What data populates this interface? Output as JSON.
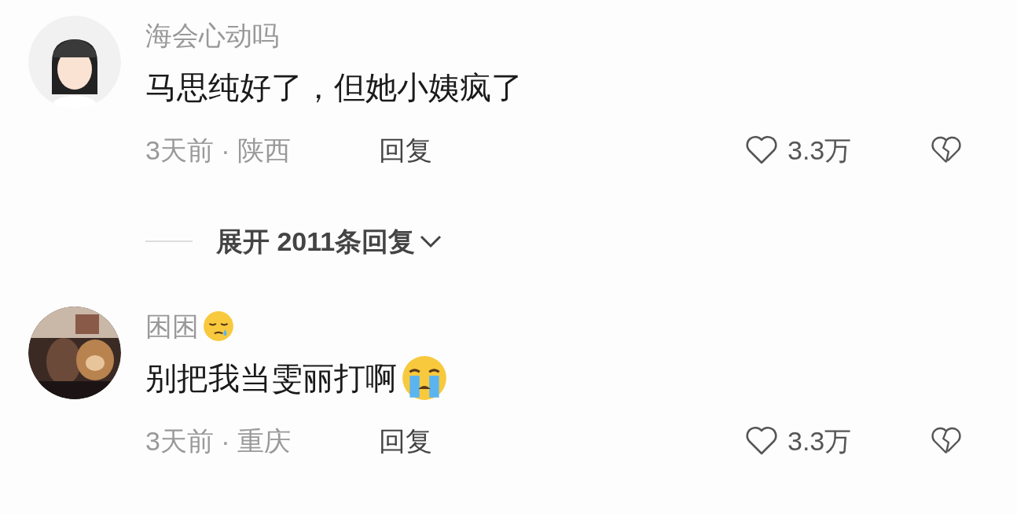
{
  "comments": [
    {
      "username": "海会心动吗",
      "avatar": {
        "kind": "illustration"
      },
      "text": "马思纯好了，但她小姨疯了",
      "meta": "3天前 · 陕西",
      "reply": "回复",
      "likes": "3.3万",
      "replies_toggle": {
        "label": "展开 2011条回复"
      }
    },
    {
      "username": "困困",
      "name_emoji": {
        "kind": "sleepy"
      },
      "text": "别把我当雯丽打啊",
      "text_emoji": {
        "kind": "crying"
      },
      "meta": "3天前 · 重庆",
      "reply": "回复",
      "likes": "3.3万"
    }
  ]
}
